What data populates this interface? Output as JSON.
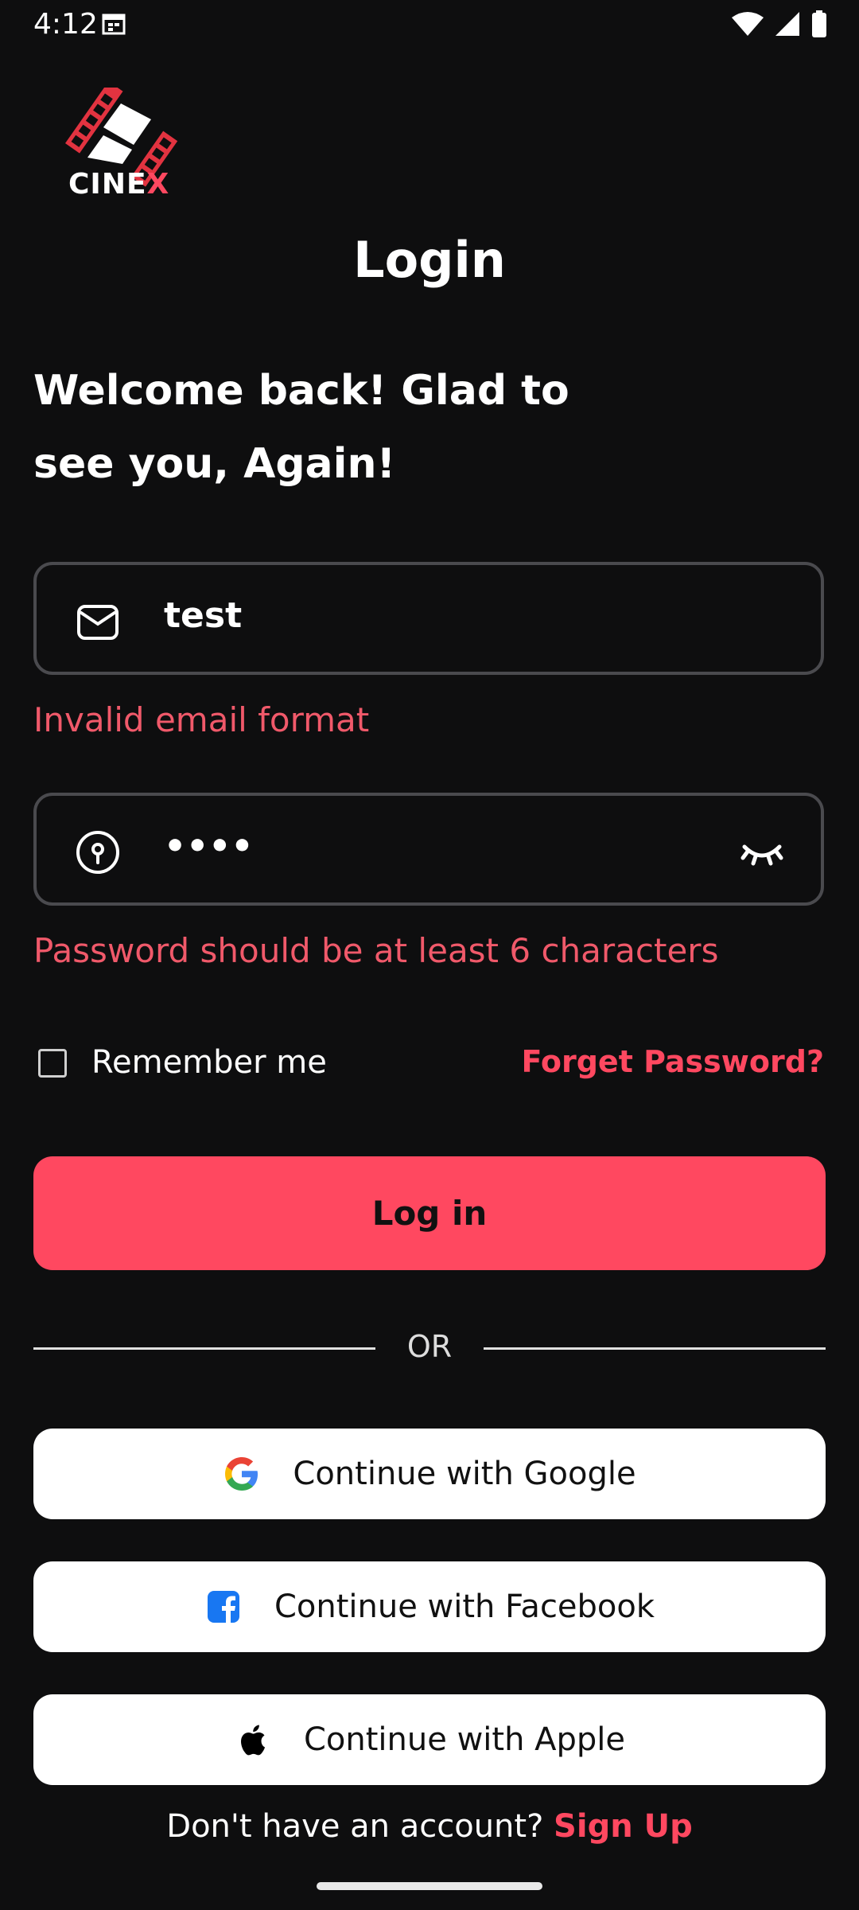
{
  "status_bar": {
    "time": "4:12"
  },
  "logo": {
    "text_main": "CINE",
    "text_x": "X"
  },
  "title": "Login",
  "welcome": "Welcome back! Glad to see you, Again!",
  "email": {
    "value": "test",
    "icon": "mail-icon",
    "error": "Invalid email format"
  },
  "password": {
    "value": "••••",
    "icon": "key-icon",
    "toggle_icon": "eye-closed-icon",
    "error": "Password should be at least 6 characters"
  },
  "remember_label": "Remember me",
  "forgot_label": "Forget Password?",
  "login_label": "Log in",
  "or_label": "OR",
  "social": {
    "google": "Continue with Google",
    "facebook": "Continue with Facebook",
    "apple": "Continue with Apple"
  },
  "footer": {
    "prompt": "Don't have an account?",
    "signup": "Sign Up"
  },
  "colors": {
    "accent": "#FF4860",
    "error": "#F0596A",
    "background": "#0E0E0F"
  }
}
